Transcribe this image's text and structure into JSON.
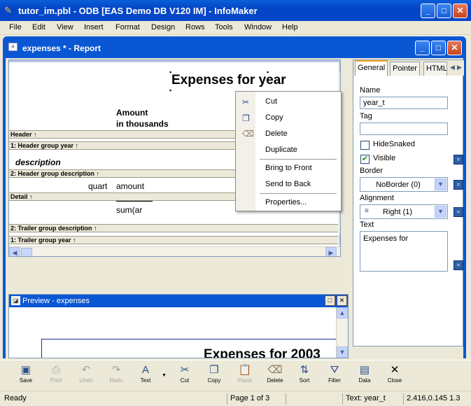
{
  "app": {
    "title": "tutor_im.pbl - ODB [EAS Demo DB V120 IM] - InfoMaker",
    "buttons": {
      "minimize": "_",
      "maximize": "□",
      "close": "✕"
    }
  },
  "menubar": [
    "File",
    "Edit",
    "View",
    "Insert",
    "Format",
    "Design",
    "Rows",
    "Tools",
    "Window",
    "Help"
  ],
  "document": {
    "title": "expenses * - Report"
  },
  "design": {
    "report_title": "Expenses for  year",
    "amount_line1": "Amount",
    "amount_line2": "in thousands",
    "bands": {
      "header": "Header ↑",
      "group1_header": "1: Header group year ↑",
      "group2_header": "2: Header group description ↑",
      "detail": "Detail ↑",
      "group2_trailer": "2: Trailer group description ↑",
      "group1_trailer": "1: Trailer group year ↑"
    },
    "description_field": "description",
    "quart_field": "quart",
    "amount_field": "amount",
    "sum_field": "sum(ar"
  },
  "context_menu": {
    "items": [
      "Cut",
      "Copy",
      "Delete",
      "Duplicate",
      "Bring to Front",
      "Send to Back",
      "Properties..."
    ]
  },
  "preview": {
    "title": "Preview - expenses",
    "report_title": "Expenses for  2003"
  },
  "properties": {
    "tabs": [
      "General",
      "Pointer",
      "HTML"
    ],
    "name_label": "Name",
    "name_value": "year_t",
    "tag_label": "Tag",
    "tag_value": "",
    "hidesnaked_label": "HideSnaked",
    "hidesnaked_checked": false,
    "visible_label": "Visible",
    "visible_checked": true,
    "border_label": "Border",
    "border_value": "NoBorder (0)",
    "alignment_label": "Alignment",
    "alignment_value": "Right (1)",
    "text_label": "Text",
    "text_value": "Expenses for"
  },
  "toolbar": {
    "buttons": [
      {
        "label": "Save",
        "icon": "save-icon",
        "enabled": true
      },
      {
        "label": "Print",
        "icon": "print-icon",
        "enabled": false
      },
      {
        "label": "Undo",
        "icon": "undo-icon",
        "enabled": false
      },
      {
        "label": "Redo",
        "icon": "redo-icon",
        "enabled": false
      },
      {
        "label": "Text",
        "icon": "text-icon",
        "enabled": true
      },
      {
        "label": "Cut",
        "icon": "cut-icon",
        "enabled": true
      },
      {
        "label": "Copy",
        "icon": "copy-icon",
        "enabled": true
      },
      {
        "label": "Paste",
        "icon": "paste-icon",
        "enabled": false
      },
      {
        "label": "Delete",
        "icon": "delete-icon",
        "enabled": true
      },
      {
        "label": "Sort",
        "icon": "sort-icon",
        "enabled": true
      },
      {
        "label": "Filter",
        "icon": "filter-icon",
        "enabled": true
      },
      {
        "label": "Data",
        "icon": "data-icon",
        "enabled": true
      },
      {
        "label": "Close",
        "icon": "close-icon",
        "enabled": true
      }
    ]
  },
  "status": {
    "ready": "Ready",
    "page": "Page 1 of 3",
    "text": "Text: year_t",
    "coords": "2.416,0.145 1.3"
  },
  "colors": {
    "titlebar": "#0548c8",
    "accent": "#0a57d4",
    "panel": "#ece9d8"
  }
}
